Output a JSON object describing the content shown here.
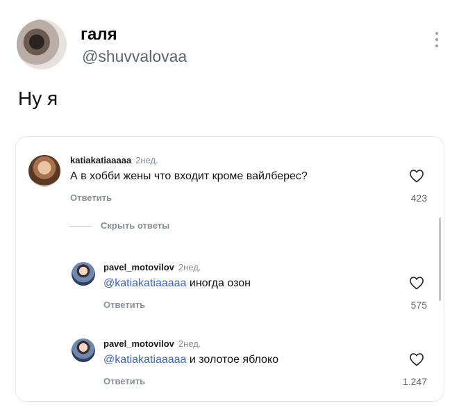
{
  "tweet": {
    "name": "галя",
    "handle": "@shuvvalovaa",
    "text": "Ну я"
  },
  "comments": {
    "main": {
      "username": "katiakatiaaaaa",
      "time": "2нед.",
      "text": "А в хобби жены что входит кроме вайлберес?",
      "reply_label": "Ответить",
      "likes": "423"
    },
    "hide_replies_label": "Скрыть ответы",
    "replies": [
      {
        "username": "pavel_motovilov",
        "time": "2нед.",
        "mention": "@katiakatiaaaaa",
        "text": " иногда озон",
        "reply_label": "Ответить",
        "likes": "575"
      },
      {
        "username": "pavel_motovilov",
        "time": "2нед.",
        "mention": "@katiakatiaaaaa",
        "text": " и золотое яблоко",
        "reply_label": "Ответить",
        "likes": "1.247"
      }
    ]
  },
  "colors": {
    "mention": "#3c64c8",
    "muted": "#8a8f96"
  },
  "icons": [
    "more-vertical-icon",
    "heart-icon"
  ]
}
